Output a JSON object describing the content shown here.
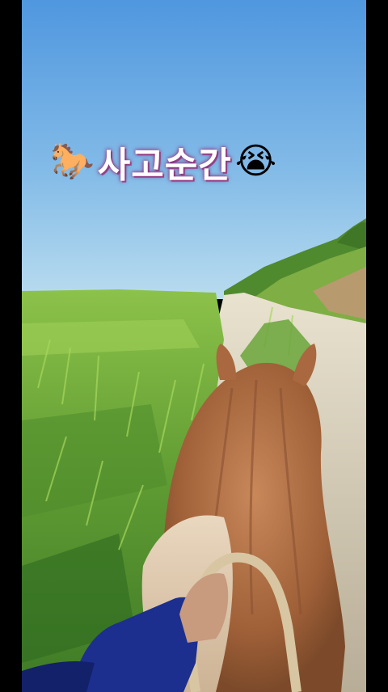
{
  "caption": {
    "horse_emoji": "🐎",
    "text": "사고순간",
    "crying_emoji": "😭"
  },
  "colors": {
    "sky_top": "#5b9fe2",
    "sky_bottom": "#a9d3ee",
    "grass": "#6aa53a",
    "horse_mane": "#b5764a",
    "glove": "#1c2f8e"
  }
}
